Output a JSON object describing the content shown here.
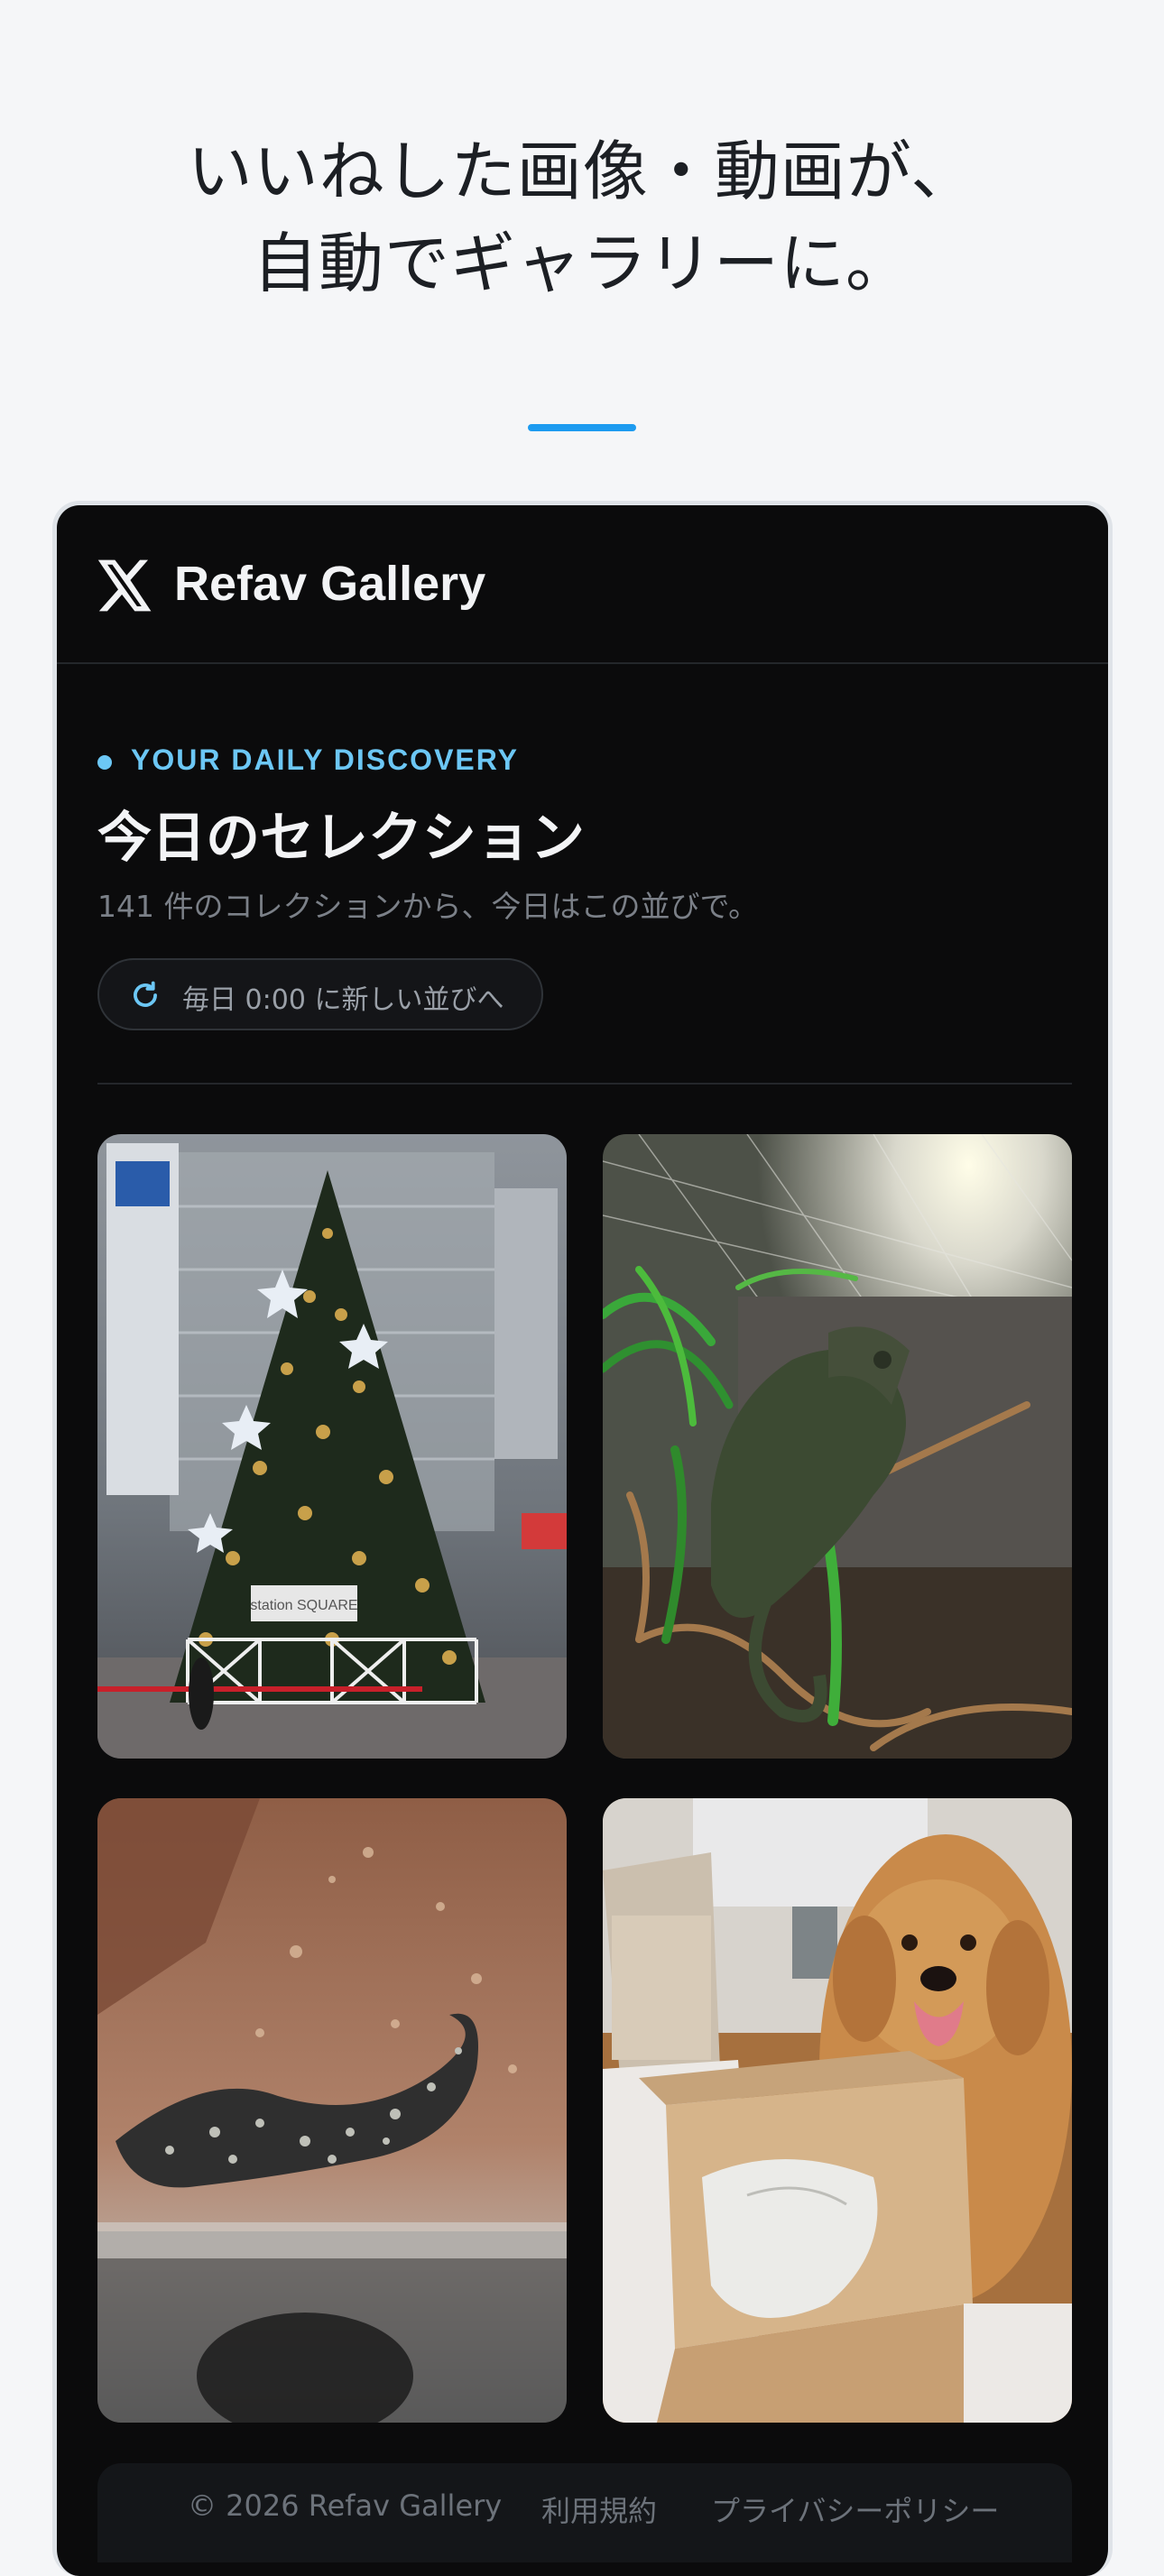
{
  "hero": {
    "line1": "いいねした画像・動画が、",
    "line2": "自動でギャラリーに。",
    "accent_color": "#1d9bf0"
  },
  "app": {
    "logo_icon": "x-logo-icon",
    "brand": "Refav Gallery"
  },
  "section": {
    "eyebrow": "YOUR DAILY DISCOVERY",
    "title": "今日のセレクション",
    "subtitle": "141 件のコレクションから、今日はこの並びで。",
    "refresh_icon": "refresh-icon",
    "refresh_text": "毎日 0:00 に新しい並びへ"
  },
  "gallery": {
    "items": [
      {
        "subject": "christmas-tree-photo"
      },
      {
        "subject": "chameleon-photo"
      },
      {
        "subject": "lizard-on-sand-photo"
      },
      {
        "subject": "golden-retriever-photo"
      }
    ],
    "tree_sign": "station SQUARE"
  },
  "footer": {
    "copyright": "© 2026 Refav Gallery",
    "terms": "利用規約",
    "privacy": "プライバシーポリシー"
  }
}
